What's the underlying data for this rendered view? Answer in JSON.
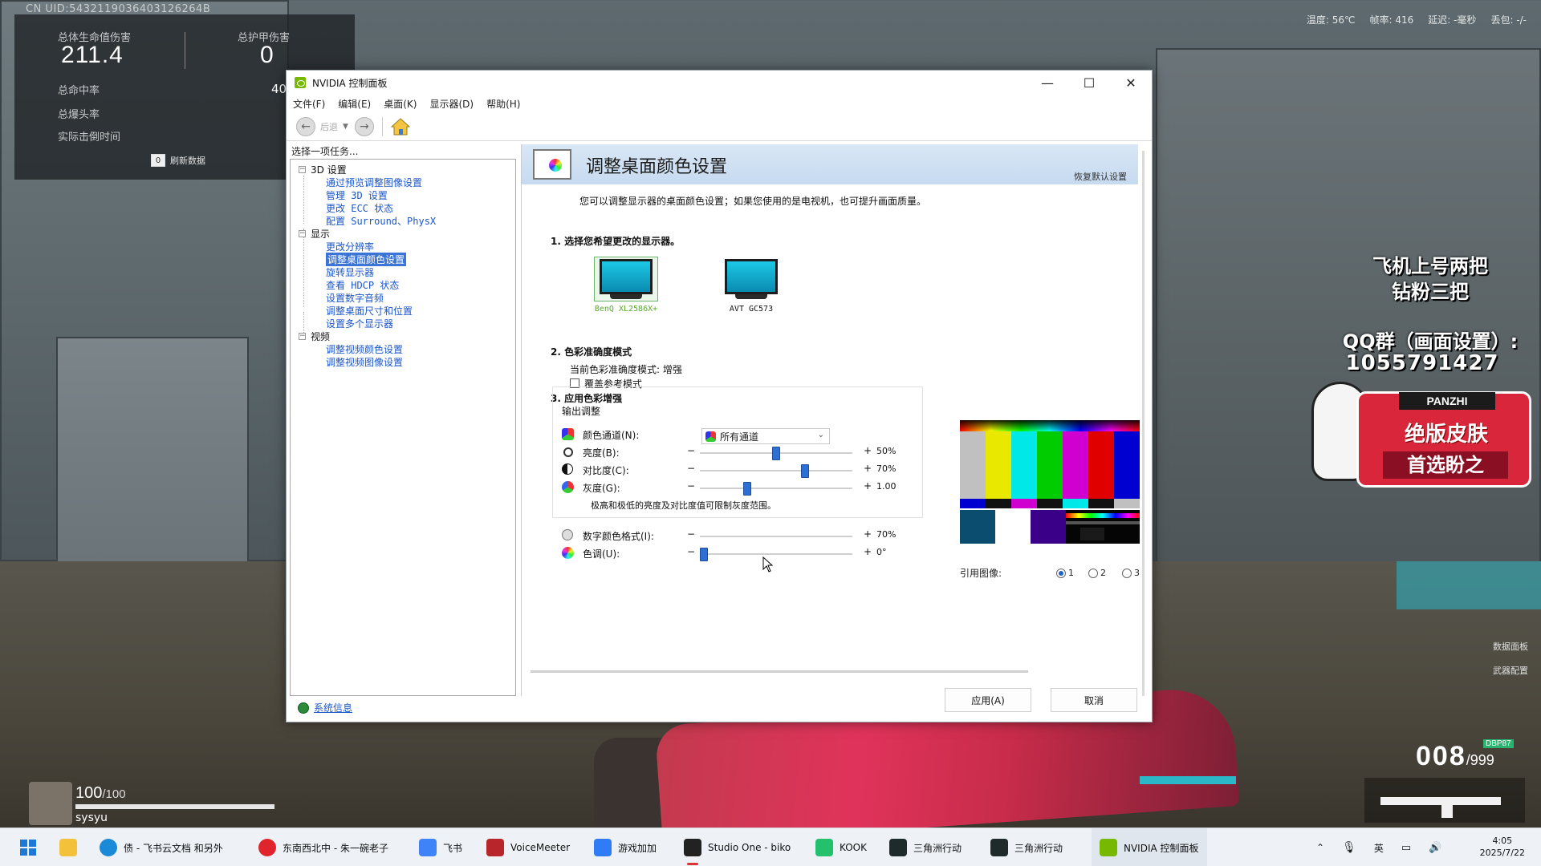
{
  "game_hud": {
    "uid": "CN UID:5432119036403126264B",
    "stats": {
      "health_damage_label": "总体生命值伤害",
      "health_damage_value": "211.4",
      "armor_damage_label": "总护甲伤害",
      "armor_damage_value": "0",
      "hit_rate_label": "总命中率",
      "hit_rate_value": "40",
      "headshot_label": "总爆头率",
      "ttk_label": "实际击倒时间",
      "refresh_key": "0",
      "refresh_label": "刷新数据"
    },
    "status": {
      "temp": "温度: 56℃",
      "fps": "帧率: 416",
      "latency": "延迟: -毫秒",
      "packet_loss": "丢包: -/-"
    },
    "promo": {
      "line1": "飞机上号两把",
      "line2": "钻粉三把",
      "qq_group": "QQ群（画面设置）:",
      "qq_number": "1055791427",
      "brand": "PANZHI",
      "badge_line1": "绝版皮肤",
      "badge_line2": "首选盼之"
    },
    "player": {
      "hp": "100",
      "hp_max": "/100",
      "hp_fraction": 1.0,
      "name": "sysyu"
    },
    "ammo": {
      "current": "008",
      "reserve": "/999",
      "mode": "DBP87"
    },
    "side_hints": {
      "data_panel": "数据面板",
      "weapon_config": "武器配置"
    }
  },
  "window": {
    "title": "NVIDIA 控制面板",
    "controls": {
      "minimize": "—",
      "maximize": "☐",
      "close": "✕"
    },
    "menu": [
      "文件(F)",
      "编辑(E)",
      "桌面(K)",
      "显示器(D)",
      "帮助(H)"
    ],
    "toolbar": {
      "back_label": "后退"
    },
    "task_header": "选择一项任务...",
    "tree": {
      "groups": [
        "3D 设置",
        "显示",
        "视频"
      ],
      "items_3d": [
        "通过预览调整图像设置",
        "管理 3D 设置",
        "更改 ECC 状态",
        "配置 Surround、PhysX"
      ],
      "items_display": [
        "更改分辨率",
        "调整桌面颜色设置",
        "旋转显示器",
        "查看 HDCP 状态",
        "设置数字音频",
        "调整桌面尺寸和位置",
        "设置多个显示器"
      ],
      "items_video": [
        "调整视频颜色设置",
        "调整视频图像设置"
      ]
    },
    "system_info": "系统信息",
    "content": {
      "title": "调整桌面颜色设置",
      "restore_defaults": "恢复默认设置",
      "description": "您可以调整显示器的桌面颜色设置；如果您使用的是电视机，也可提升画面质量。",
      "section1": "1. 选择您希望更改的显示器。",
      "monitors": [
        "BenQ XL2586X+",
        "AVT GC573"
      ],
      "section2": "2. 色彩准确度模式",
      "current_mode": "当前色彩准确度模式: 增强",
      "override_reference": "覆盖参考模式",
      "section3": "3. 应用色彩增强",
      "output_adjust": "输出调整",
      "channel_label": "颜色通道(N):",
      "channel_value": "所有通道",
      "sliders": [
        {
          "label": "亮度(B):",
          "value": "50%",
          "level": 0.5
        },
        {
          "label": "对比度(C):",
          "value": "70%",
          "level": 0.7
        },
        {
          "label": "灰度(G):",
          "value": "1.00",
          "level": 0.3
        }
      ],
      "note": "极高和极低的亮度及对比度值可限制灰度范围。",
      "vibrance": {
        "label": "数字颜色格式(I):",
        "value": "70%",
        "level": 0.7
      },
      "hue": {
        "label": "色调(U):",
        "value": "0°",
        "level": 0.0
      },
      "reference_image_label": "引用图像:",
      "reference_options": [
        "1",
        "2",
        "3"
      ],
      "reference_selected": "1"
    },
    "buttons": {
      "apply": "应用(A)",
      "cancel": "取消"
    }
  },
  "taskbar": {
    "items": [
      {
        "label": "债 - 飞书云文档 和另外",
        "color": "#1a8ad8"
      },
      {
        "label": "东南西北中 - 朱一碗老子",
        "color": "#e0242b"
      },
      {
        "label": "飞书",
        "color": "#3f83f8"
      },
      {
        "label": "VoiceMeeter",
        "color": "#b8262b"
      },
      {
        "label": "游戏加加",
        "color": "#2f7cf6"
      },
      {
        "label": "Studio One - biko",
        "color": "#222222"
      },
      {
        "label": "KOOK",
        "color": "#25c06b"
      },
      {
        "label": "三角洲行动",
        "color": "#1f2b2a"
      },
      {
        "label": "三角洲行动",
        "color": "#1f2b2a"
      },
      {
        "label": "NVIDIA 控制面板",
        "color": "#76b900"
      }
    ],
    "ime": "英",
    "time": "4:05",
    "date": "2025/7/22"
  }
}
